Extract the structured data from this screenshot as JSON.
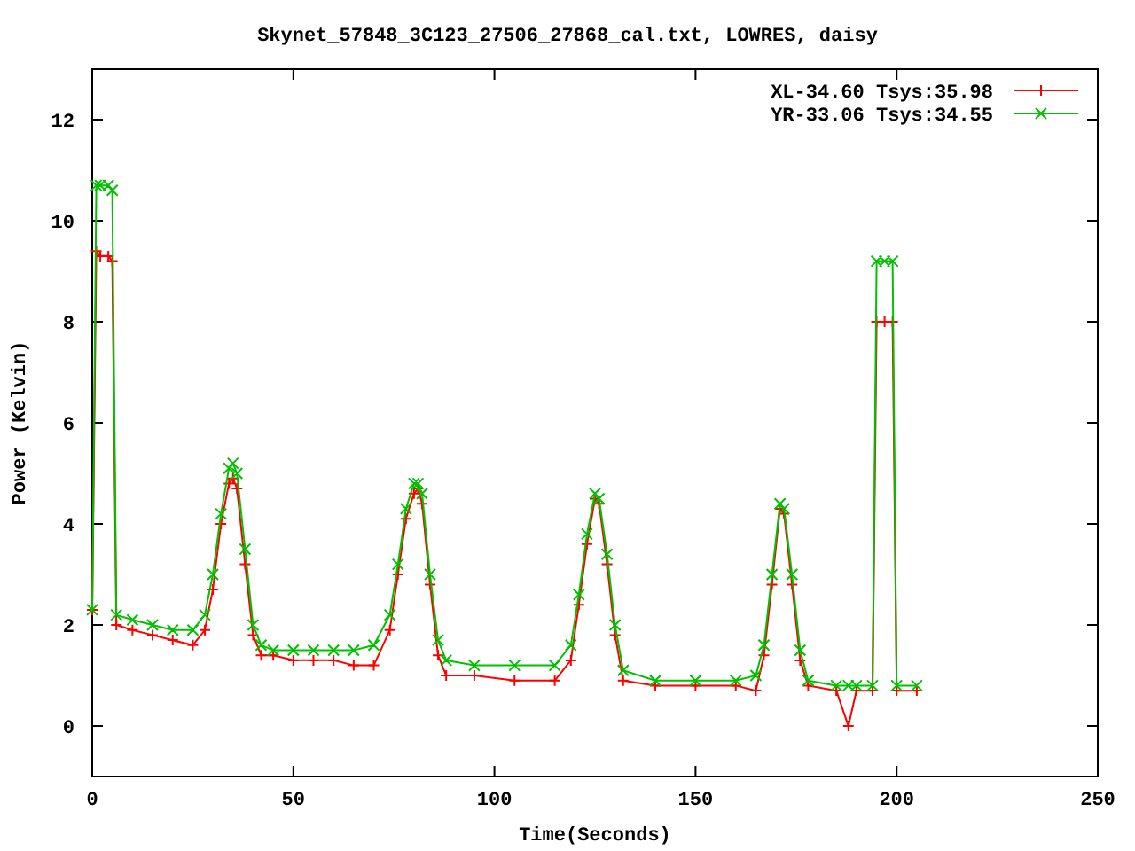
{
  "chart_data": {
    "type": "line",
    "title": "Skynet_57848_3C123_27506_27868_cal.txt, LOWRES, daisy",
    "xlabel": "Time(Seconds)",
    "ylabel": "Power (Kelvin)",
    "x": [
      0,
      1,
      2,
      4,
      5,
      6,
      10,
      15,
      20,
      25,
      28,
      30,
      32,
      34,
      35,
      36,
      38,
      40,
      42,
      45,
      50,
      55,
      60,
      65,
      70,
      74,
      76,
      78,
      80,
      81,
      82,
      84,
      86,
      88,
      95,
      105,
      115,
      119,
      121,
      123,
      125,
      126,
      128,
      130,
      132,
      140,
      150,
      160,
      165,
      167,
      169,
      171,
      172,
      174,
      176,
      178,
      185,
      188,
      190,
      194,
      195,
      197,
      199,
      200,
      205
    ],
    "series": [
      {
        "name": "XL-34.60 Tsys:35.98",
        "color": "#ff0000",
        "marker": "plus",
        "values": [
          2.3,
          9.4,
          9.3,
          9.3,
          9.2,
          2.0,
          1.9,
          1.8,
          1.7,
          1.6,
          1.9,
          2.7,
          4.0,
          4.8,
          4.9,
          4.7,
          3.2,
          1.8,
          1.4,
          1.4,
          1.3,
          1.3,
          1.3,
          1.2,
          1.2,
          1.9,
          3.0,
          4.1,
          4.6,
          4.7,
          4.4,
          2.8,
          1.4,
          1.0,
          1.0,
          0.9,
          0.9,
          1.3,
          2.4,
          3.6,
          4.5,
          4.4,
          3.2,
          1.8,
          0.9,
          0.8,
          0.8,
          0.8,
          0.7,
          1.4,
          2.8,
          4.3,
          4.2,
          2.8,
          1.3,
          0.8,
          0.7,
          0.0,
          0.7,
          0.7,
          8.0,
          8.0,
          8.0,
          0.7,
          0.7
        ]
      },
      {
        "name": "YR-33.06 Tsys:34.55",
        "color": "#00c000",
        "marker": "cross",
        "values": [
          2.3,
          10.7,
          10.7,
          10.7,
          10.6,
          2.2,
          2.1,
          2.0,
          1.9,
          1.9,
          2.2,
          3.0,
          4.2,
          5.1,
          5.2,
          5.0,
          3.5,
          2.0,
          1.6,
          1.5,
          1.5,
          1.5,
          1.5,
          1.5,
          1.6,
          2.2,
          3.2,
          4.3,
          4.8,
          4.8,
          4.6,
          3.0,
          1.7,
          1.3,
          1.2,
          1.2,
          1.2,
          1.6,
          2.6,
          3.8,
          4.6,
          4.5,
          3.4,
          2.0,
          1.1,
          0.9,
          0.9,
          0.9,
          1.0,
          1.6,
          3.0,
          4.4,
          4.3,
          3.0,
          1.5,
          0.9,
          0.8,
          0.8,
          0.8,
          0.8,
          9.2,
          9.2,
          9.2,
          0.8,
          0.8
        ]
      }
    ],
    "legend": true,
    "xlim": [
      0,
      250
    ],
    "ylim": [
      -1,
      13
    ],
    "xticks": [
      0,
      50,
      100,
      150,
      200,
      250
    ],
    "yticks": [
      0,
      2,
      4,
      6,
      8,
      10,
      12
    ]
  }
}
